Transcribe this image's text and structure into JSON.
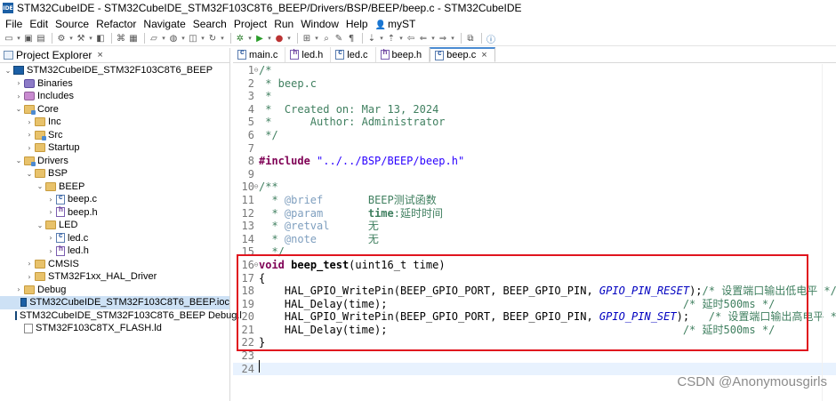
{
  "window": {
    "title": "STM32CubeIDE - STM32CubeIDE_STM32F103C8T6_BEEP/Drivers/BSP/BEEP/beep.c - STM32CubeIDE",
    "app_icon_label": "IDE"
  },
  "menu": [
    "File",
    "Edit",
    "Source",
    "Refactor",
    "Navigate",
    "Search",
    "Project",
    "Run",
    "Window",
    "Help",
    "myST"
  ],
  "explorer": {
    "title": "Project Explorer",
    "tree": [
      {
        "label": "STM32CubeIDE_STM32F103C8T6_BEEP",
        "icon": "project-icon",
        "arrow": "⌄",
        "indent": 0
      },
      {
        "label": "Binaries",
        "icon": "binaries-icon",
        "arrow": "›",
        "indent": 1
      },
      {
        "label": "Includes",
        "icon": "includes-icon",
        "arrow": "›",
        "indent": 1
      },
      {
        "label": "Core",
        "icon": "source-folder-icon",
        "arrow": "⌄",
        "indent": 1
      },
      {
        "label": "Inc",
        "icon": "folder-icon",
        "arrow": "›",
        "indent": 2
      },
      {
        "label": "Src",
        "icon": "source-folder-icon",
        "arrow": "›",
        "indent": 2
      },
      {
        "label": "Startup",
        "icon": "folder-icon",
        "arrow": "›",
        "indent": 2
      },
      {
        "label": "Drivers",
        "icon": "source-folder-icon",
        "arrow": "⌄",
        "indent": 1
      },
      {
        "label": "BSP",
        "icon": "folder-icon",
        "arrow": "⌄",
        "indent": 2
      },
      {
        "label": "BEEP",
        "icon": "folder-icon",
        "arrow": "⌄",
        "indent": 3
      },
      {
        "label": "beep.c",
        "icon": "c-file-icon",
        "arrow": "›",
        "indent": 4
      },
      {
        "label": "beep.h",
        "icon": "h-file-icon",
        "arrow": "›",
        "indent": 4
      },
      {
        "label": "LED",
        "icon": "folder-icon",
        "arrow": "⌄",
        "indent": 3
      },
      {
        "label": "led.c",
        "icon": "c-file-icon",
        "arrow": "›",
        "indent": 4
      },
      {
        "label": "led.h",
        "icon": "h-file-icon",
        "arrow": "›",
        "indent": 4
      },
      {
        "label": "CMSIS",
        "icon": "folder-icon",
        "arrow": "›",
        "indent": 2
      },
      {
        "label": "STM32F1xx_HAL_Driver",
        "icon": "folder-icon",
        "arrow": "›",
        "indent": 2
      },
      {
        "label": "Debug",
        "icon": "folder-icon",
        "arrow": "›",
        "indent": 1
      },
      {
        "label": "STM32CubeIDE_STM32F103C8T6_BEEP.ioc",
        "icon": "ioc-file-icon",
        "arrow": "",
        "indent": 1,
        "selected": true
      },
      {
        "label": "STM32CubeIDE_STM32F103C8T6_BEEP Debug.l",
        "icon": "launch-file-icon",
        "arrow": "",
        "indent": 1
      },
      {
        "label": "STM32F103C8TX_FLASH.ld",
        "icon": "ld-file-icon",
        "arrow": "",
        "indent": 1
      }
    ]
  },
  "editor": {
    "tabs": [
      {
        "label": "main.c",
        "kind": "c",
        "active": false
      },
      {
        "label": "led.h",
        "kind": "h",
        "active": false
      },
      {
        "label": "led.c",
        "kind": "c",
        "active": false
      },
      {
        "label": "beep.h",
        "kind": "h",
        "active": false
      },
      {
        "label": "beep.c",
        "kind": "c",
        "active": true
      }
    ],
    "lines": [
      {
        "n": "1",
        "fold": "⊖",
        "parts": [
          [
            "c-comment",
            "/*"
          ]
        ]
      },
      {
        "n": "2",
        "parts": [
          [
            "c-comment",
            " * beep.c"
          ]
        ]
      },
      {
        "n": "3",
        "parts": [
          [
            "c-comment",
            " *"
          ]
        ]
      },
      {
        "n": "4",
        "parts": [
          [
            "c-comment",
            " *  Created on: Mar 13, 2024"
          ]
        ]
      },
      {
        "n": "5",
        "parts": [
          [
            "c-comment",
            " *      Author: Administrator"
          ]
        ]
      },
      {
        "n": "6",
        "parts": [
          [
            "c-comment",
            " */"
          ]
        ]
      },
      {
        "n": "7",
        "parts": []
      },
      {
        "n": "8",
        "parts": [
          [
            "c-keyword",
            "#include"
          ],
          [
            "",
            " "
          ],
          [
            "c-string",
            "\"../../BSP/BEEP/beep.h\""
          ]
        ]
      },
      {
        "n": "9",
        "parts": []
      },
      {
        "n": "10",
        "fold": "⊖",
        "parts": [
          [
            "c-comment",
            "/**"
          ]
        ]
      },
      {
        "n": "11",
        "parts": [
          [
            "c-comment",
            "  * "
          ],
          [
            "c-tag",
            "@brief"
          ],
          [
            "c-comment",
            "       BEEP测试函数"
          ]
        ]
      },
      {
        "n": "12",
        "parts": [
          [
            "c-comment",
            "  * "
          ],
          [
            "c-tag",
            "@param"
          ],
          [
            "c-comment",
            "       "
          ],
          [
            "c-comment c-bold",
            "time"
          ],
          [
            "c-comment",
            ":延时时间"
          ]
        ]
      },
      {
        "n": "13",
        "parts": [
          [
            "c-comment",
            "  * "
          ],
          [
            "c-tag",
            "@retval"
          ],
          [
            "c-comment",
            "      无"
          ]
        ]
      },
      {
        "n": "14",
        "parts": [
          [
            "c-comment",
            "  * "
          ],
          [
            "c-tag",
            "@note"
          ],
          [
            "c-comment",
            "        无"
          ]
        ]
      },
      {
        "n": "15",
        "parts": [
          [
            "c-comment",
            "  */"
          ]
        ]
      },
      {
        "n": "16",
        "fold": "⊖",
        "parts": [
          [
            "c-keyword",
            "void"
          ],
          [
            "",
            " "
          ],
          [
            "c-bold",
            "beep_test"
          ],
          [
            "",
            "(uint16_t time)"
          ]
        ]
      },
      {
        "n": "17",
        "parts": [
          [
            "",
            "{"
          ]
        ]
      },
      {
        "n": "18",
        "parts": [
          [
            "",
            "    HAL_GPIO_WritePin(BEEP_GPIO_PORT, BEEP_GPIO_PIN, "
          ],
          [
            "c-macro",
            "GPIO_PIN_RESET"
          ],
          [
            "",
            ");"
          ],
          [
            "c-comment",
            "/* 设置端口输出低电平 */"
          ]
        ]
      },
      {
        "n": "19",
        "parts": [
          [
            "",
            "    HAL_Delay(time);                                              "
          ],
          [
            "c-comment",
            "/* 延时500ms */"
          ]
        ]
      },
      {
        "n": "20",
        "parts": [
          [
            "",
            "    HAL_GPIO_WritePin(BEEP_GPIO_PORT, BEEP_GPIO_PIN, "
          ],
          [
            "c-macro",
            "GPIO_PIN_SET"
          ],
          [
            "",
            ");   "
          ],
          [
            "c-comment",
            "/* 设置端口输出高电平 */"
          ]
        ]
      },
      {
        "n": "21",
        "parts": [
          [
            "",
            "    HAL_Delay(time);                                              "
          ],
          [
            "c-comment",
            "/* 延时500ms */"
          ]
        ]
      },
      {
        "n": "22",
        "parts": [
          [
            "",
            "}"
          ]
        ]
      },
      {
        "n": "23",
        "parts": []
      },
      {
        "n": "24",
        "parts": [],
        "cursor": true
      }
    ]
  },
  "watermark": "CSDN @Anonymousgirls"
}
